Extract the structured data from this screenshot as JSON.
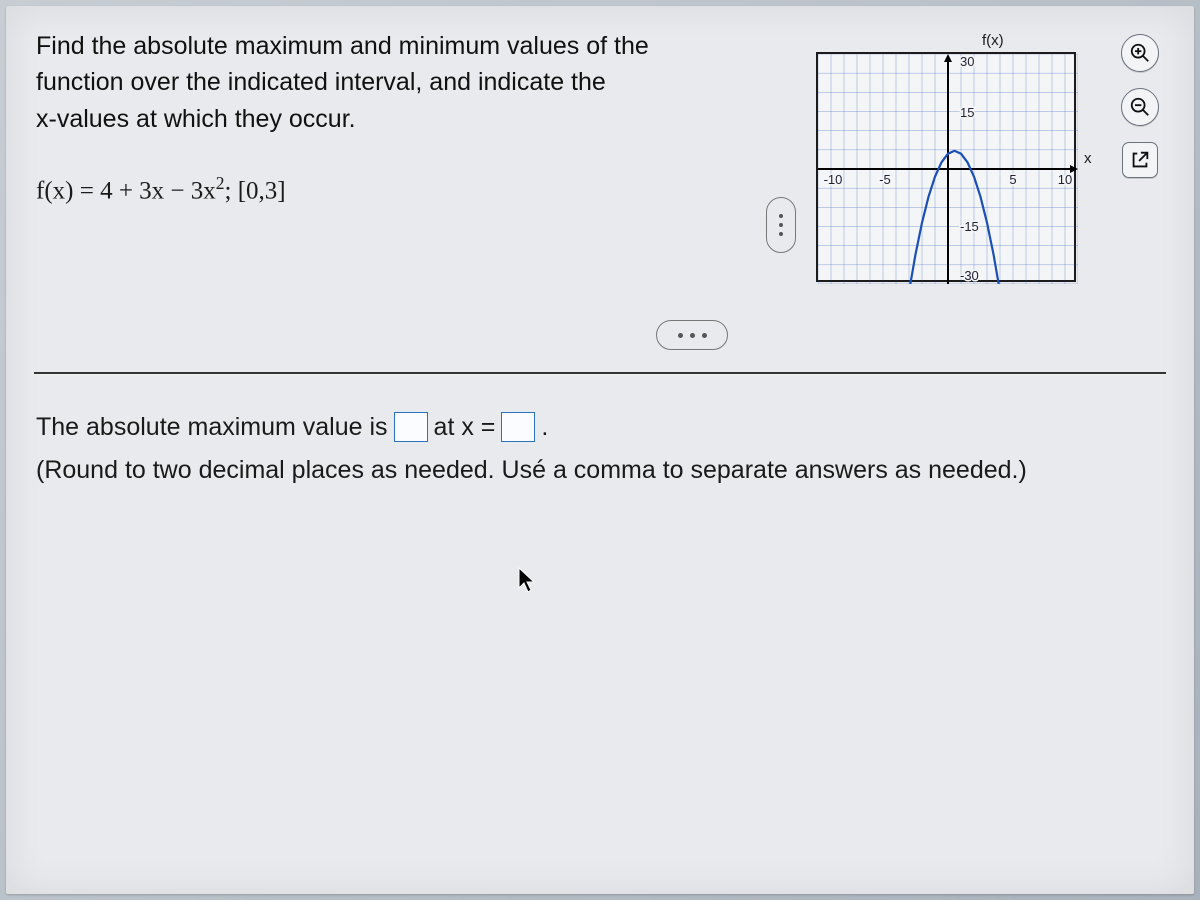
{
  "prompt": {
    "line1": "Find the absolute maximum and minimum values of the",
    "line2": "function over the indicated interval, and indicate the",
    "line3": "x-values at which they occur."
  },
  "function_lhs": "f(x) = 4 + 3x − 3x",
  "function_exp": "2",
  "function_interval": "; [0,3]",
  "chart_data": {
    "type": "line",
    "title": "",
    "xlabel": "x",
    "ylabel": "f(x)",
    "xlim": [
      -10,
      10
    ],
    "ylim": [
      -30,
      30
    ],
    "xticks": [
      -10,
      -5,
      5,
      10
    ],
    "yticks": [
      -30,
      -15,
      15,
      30
    ],
    "series": [
      {
        "name": "f(x)=4+3x-3x^2",
        "x": [
          -3.5,
          -3,
          -2.5,
          -2,
          -1.5,
          -1,
          -0.5,
          0,
          0.5,
          1,
          1.5,
          2,
          2.5,
          3,
          3.5,
          4
        ],
        "y": [
          -43.25,
          -32,
          -22.25,
          -14,
          -7.25,
          -2,
          1.75,
          4,
          4.75,
          4,
          1.75,
          -2,
          -7.25,
          -14,
          -22.25,
          -32
        ]
      }
    ],
    "interval_highlight": {
      "xmin": 0,
      "xmax": 3
    }
  },
  "answer": {
    "prefix": "The absolute maximum value is",
    "mid": "at x =",
    "period": ".",
    "hint": "(Round to two decimal places as needed. Usé a comma to separate answers as needed.)"
  },
  "icons": {
    "zoom_in": "zoom-in-icon",
    "zoom_out": "zoom-out-icon",
    "open_new": "open-new-icon"
  },
  "ellipsis": "..."
}
